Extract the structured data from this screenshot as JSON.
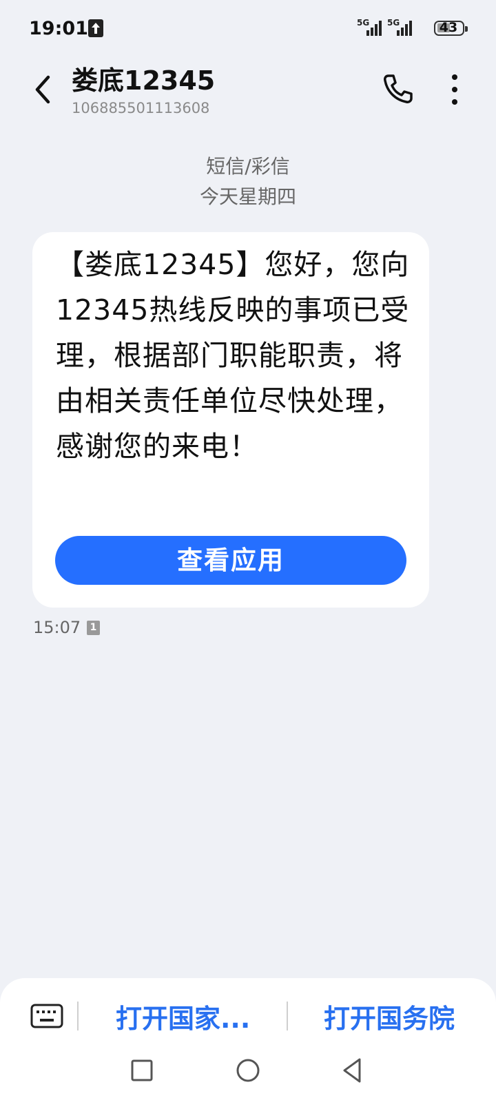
{
  "status_bar": {
    "time": "19:01",
    "network_1": "5G",
    "network_2": "5G",
    "battery": "43"
  },
  "header": {
    "contact_name": "娄底12345",
    "contact_number": "106885501113608"
  },
  "thread": {
    "message_type": "短信/彩信",
    "date": "今天星期四",
    "messages": [
      {
        "text": "【娄底12345】您好，您向12345热线反映的事项已受理，根据部门职能职责，将由相关责任单位尽快处理，感谢您的来电！",
        "action_button": "查看应用",
        "time": "15:07",
        "sim": "1"
      }
    ]
  },
  "bottom_bar": {
    "quick_replies": [
      "打开国家...",
      "打开国务院"
    ]
  },
  "colors": {
    "accent": "#256fff",
    "quick_reply_text": "#2870f0",
    "background": "#eff1f6"
  },
  "icons": [
    "up-arrow-icon",
    "signal-icon",
    "battery-icon",
    "back-icon",
    "phone-icon",
    "more-vertical-icon",
    "sim-icon",
    "keyboard-icon",
    "recents-icon",
    "home-icon",
    "back-nav-icon"
  ]
}
